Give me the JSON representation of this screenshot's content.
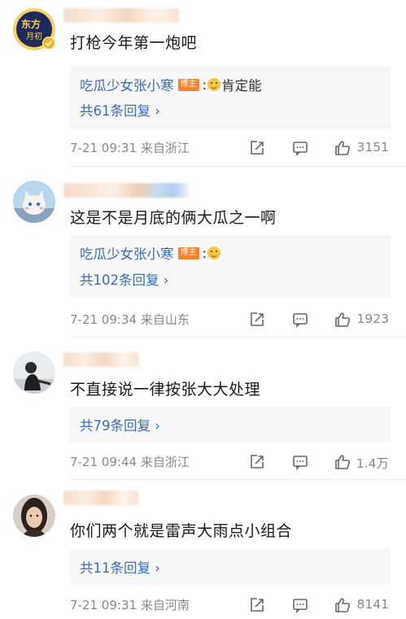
{
  "comments": [
    {
      "text": "打枪今年第一炮吧",
      "reply_preview": {
        "author": "吃瓜少女张小寒",
        "badge": "博主",
        "colon": ":",
        "text": "肯定能"
      },
      "reply_count": "共61条回复 ›",
      "time": "7-21 09:31",
      "location": "来自浙江",
      "likes": "3151"
    },
    {
      "text": "这是不是月底的俩大瓜之一啊",
      "reply_preview": {
        "author": "吃瓜少女张小寒",
        "badge": "博主",
        "colon": ":",
        "text": ""
      },
      "reply_count": "共102条回复 ›",
      "time": "7-21 09:34",
      "location": "来自山东",
      "likes": "1923"
    },
    {
      "text": "不直接说一律按张大大处理",
      "reply_count": "共79条回复 ›",
      "time": "7-21 09:44",
      "location": "来自浙江",
      "likes": "1.4万"
    },
    {
      "text": "你们两个就是雷声大雨点小组合",
      "reply_count": "共11条回复 ›",
      "time": "7-21 09:31",
      "location": "来自河南",
      "likes": "8141"
    }
  ],
  "icons": {
    "share": "share-icon",
    "comment": "comment-icon",
    "like": "thumbs-up-icon",
    "avatar_badge": "verified-badge-icon"
  },
  "colors": {
    "link": "#3c6cb5",
    "badge": "#f7832d",
    "meta": "#888888",
    "reply_bg": "#f7f7f7"
  }
}
